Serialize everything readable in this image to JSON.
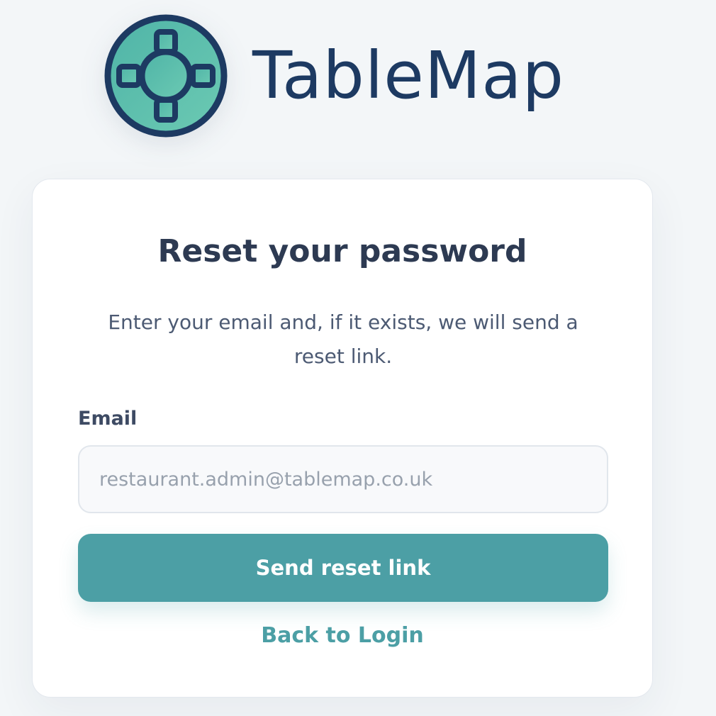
{
  "brand": {
    "name": "TableMap",
    "logo_icon": "lifebuoy-table-icon",
    "colors": {
      "dark": "#1d3a62",
      "teal": "#5bbfae"
    }
  },
  "form": {
    "title": "Reset your password",
    "subtitle": "Enter your email and, if it exists, we will send a reset link.",
    "email_label": "Email",
    "email_placeholder": "restaurant.admin@tablemap.co.uk",
    "email_value": "",
    "submit_label": "Send reset link",
    "back_link_label": "Back to Login"
  },
  "colors": {
    "accent": "#4c9fa5",
    "heading": "#2d3a52",
    "background": "#f3f6f8"
  }
}
